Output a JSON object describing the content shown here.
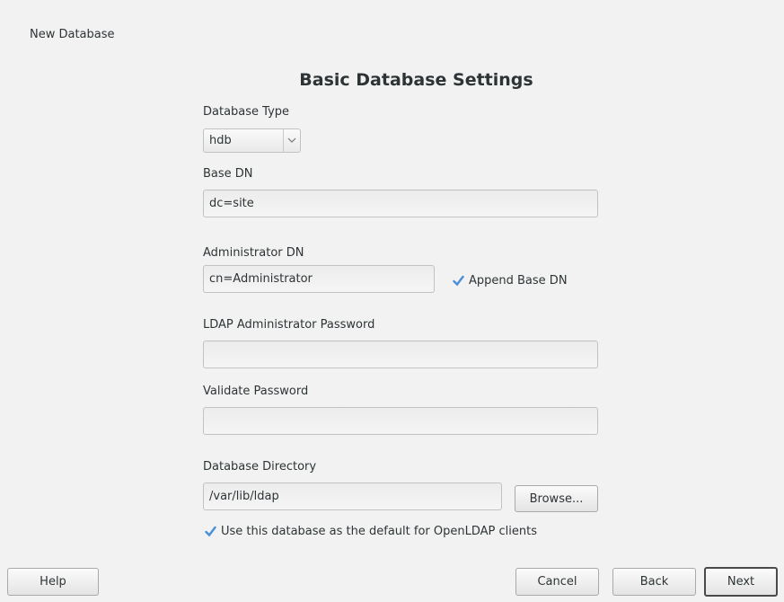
{
  "window": {
    "title": "New Database"
  },
  "heading": "Basic Database Settings",
  "db_type": {
    "label": "Database Type",
    "value": "hdb"
  },
  "base_dn": {
    "label": "Base DN",
    "value": "dc=site"
  },
  "admin_dn": {
    "label": "Administrator DN",
    "value": "cn=Administrator",
    "append_label": "Append Base DN",
    "append_checked": true
  },
  "admin_password": {
    "label": "LDAP Administrator Password",
    "value": ""
  },
  "validate_password": {
    "label": "Validate Password",
    "value": ""
  },
  "db_dir": {
    "label": "Database Directory",
    "value": "/var/lib/ldap",
    "browse_label": "Browse..."
  },
  "default_db": {
    "label": "Use this database as the default for OpenLDAP clients",
    "checked": true
  },
  "buttons": {
    "help": "Help",
    "cancel": "Cancel",
    "back": "Back",
    "next": "Next"
  },
  "colors": {
    "background": "#f2f2f2",
    "check_accent": "#4a90d9"
  },
  "icons": {
    "check": "checkmark-icon",
    "dropdown": "chevron-down-icon"
  }
}
